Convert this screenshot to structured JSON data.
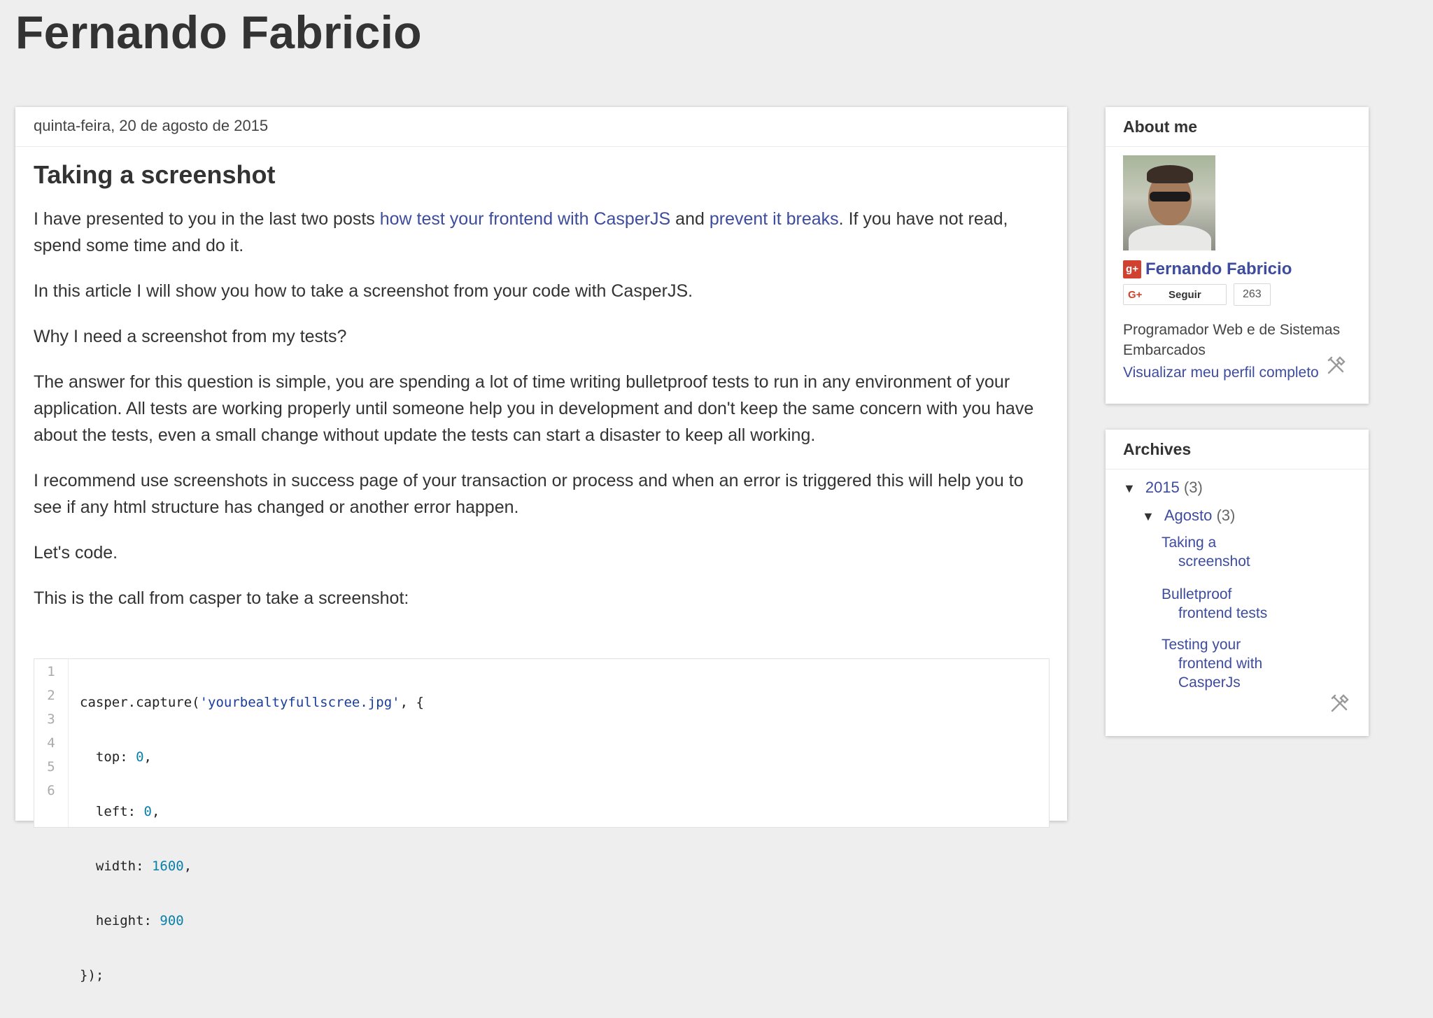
{
  "blog": {
    "title": "Fernando Fabricio"
  },
  "post": {
    "date": "quinta-feira, 20 de agosto de 2015",
    "title": "Taking a screenshot",
    "p1_before": "I have presented to you in the last two posts ",
    "p1_link1": "how test your frontend with CasperJS",
    "p1_mid": " and ",
    "p1_link2": "prevent it breaks",
    "p1_after": ". If you have not read, spend some time and do it.",
    "p2": "In this article I will show you how to take a screenshot from your code with CasperJS.",
    "p3": "Why I need a screenshot from my tests?",
    "p4": "The answer for this question is simple, you are spending a lot of time writing bulletproof tests to run in any environment of your application. All tests are working properly until someone help you in development and don't keep the same concern with you have about the tests, even a small change without update the tests can start a disaster to keep all working.",
    "p5": "I recommend use screenshots in success page of your transaction or process and when an error is triggered this will help you to see if any html structure has changed or another error happen.",
    "p6": "Let's code.",
    "p7": "This is the call from casper to take a screenshot:"
  },
  "code": {
    "line_numbers": [
      "1",
      "2",
      "3",
      "4",
      "5",
      "6"
    ],
    "l1_a": "casper.capture(",
    "l1_str": "'yourbealtyfullscree.jpg'",
    "l1_b": ", {",
    "l2_key": "  top: ",
    "l2_val": "0",
    "l2_end": ",",
    "l3_key": "  left: ",
    "l3_val": "0",
    "l3_end": ",",
    "l4_key": "  width: ",
    "l4_val": "1600",
    "l4_end": ",",
    "l5_key": "  height: ",
    "l5_val": "900",
    "l6": "});"
  },
  "about": {
    "title": "About me",
    "name": "Fernando Fabricio",
    "gplus_badge": "g+",
    "follow_icon": "G+",
    "follow_label": "Seguir",
    "follow_count": "263",
    "description": "Programador Web e de Sistemas Embarcados",
    "profile_link": "Visualizar meu perfil completo"
  },
  "archives": {
    "title": "Archives",
    "year_arrow": "▼",
    "year": "2015",
    "year_count": "(3)",
    "month_arrow": "▼",
    "month": "Agosto",
    "month_count": "(3)",
    "posts": [
      {
        "l1": "Taking a",
        "l2": "screenshot"
      },
      {
        "l1": "Bulletproof",
        "l2": "frontend tests"
      },
      {
        "l1": "Testing your",
        "l2": "frontend with CasperJs"
      }
    ]
  },
  "colors": {
    "background": "#eeeeee",
    "link": "#3d4c9c",
    "gplus_red": "#d0422f"
  }
}
